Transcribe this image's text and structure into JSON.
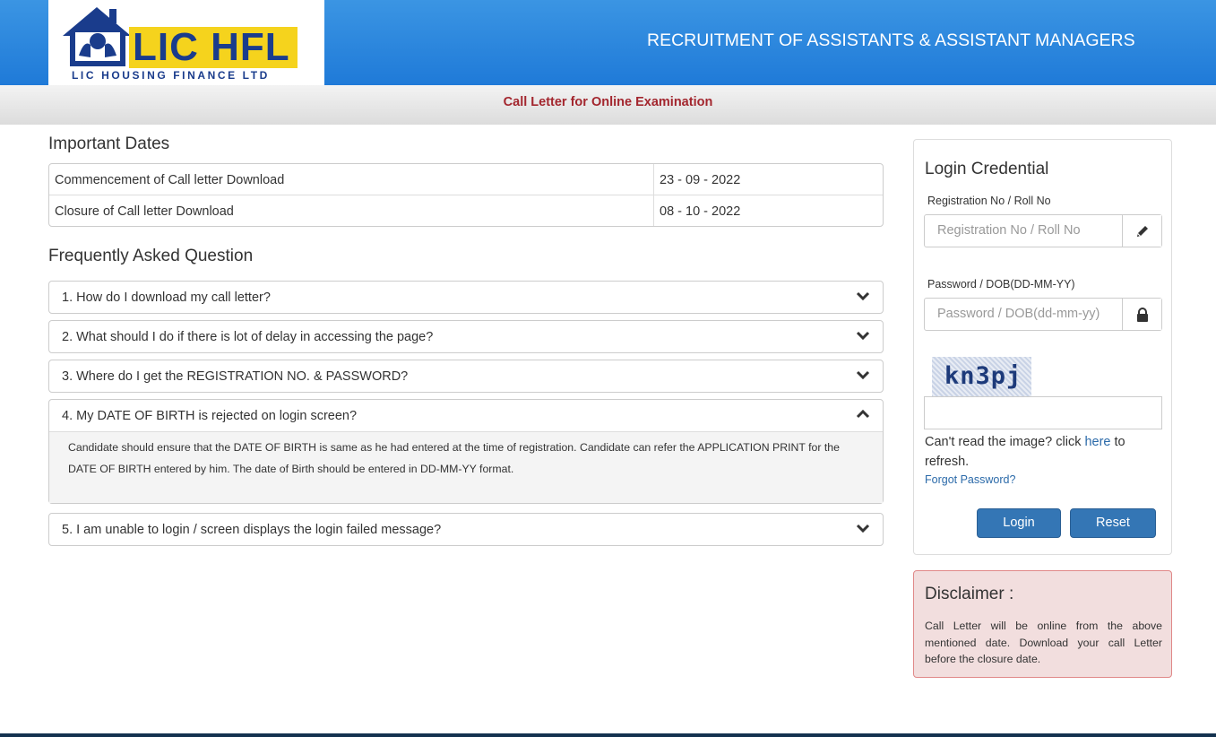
{
  "header": {
    "logo_text": "LIC HFL",
    "logo_subtext": "LIC HOUSING FINANCE LTD",
    "title": "RECRUITMENT OF ASSISTANTS & ASSISTANT MANAGERS",
    "brand_blue": "#1f7ad8",
    "logo_yellow": "#f5d31d"
  },
  "subheader": {
    "title": "Call Letter for Online Examination"
  },
  "important_dates": {
    "heading": "Important Dates",
    "rows": [
      {
        "label": "Commencement of Call letter Download",
        "value": "23 - 09 - 2022"
      },
      {
        "label": "Closure of Call letter Download",
        "value": "08 - 10 - 2022"
      }
    ]
  },
  "faq": {
    "heading": "Frequently Asked Question",
    "items": [
      {
        "question": "1. How do I download my call letter?",
        "expanded": false
      },
      {
        "question": "2. What should I do if there is lot of delay in accessing the page?",
        "expanded": false
      },
      {
        "question": "3. Where do I get the REGISTRATION NO. & PASSWORD?",
        "expanded": false
      },
      {
        "question": "4. My DATE OF BIRTH is rejected on login screen?",
        "expanded": true,
        "answer": "Candidate should ensure that the DATE OF BIRTH is same as he had entered at the time of registration. Candidate can refer the APPLICATION PRINT for the DATE OF BIRTH entered by him. The date of Birth should be entered in DD-MM-YY format."
      },
      {
        "question": "5. I am unable to login / screen displays the login failed message?",
        "expanded": false
      }
    ]
  },
  "login": {
    "title": "Login Credential",
    "reg_label": "Registration No / Roll No",
    "reg_placeholder": "Registration No / Roll No",
    "reg_icon": "pencil-icon",
    "pwd_label": "Password / DOB(DD-MM-YY)",
    "pwd_placeholder": "Password / DOB(dd-mm-yy)",
    "pwd_icon": "lock-icon",
    "captcha_text": "kn3pj",
    "refresh_prefix": "Can't read the image? click ",
    "refresh_link": "here",
    "refresh_suffix": " to refresh.",
    "forgot": "Forgot Password?",
    "login_button": "Login",
    "reset_button": "Reset",
    "button_color": "#3476b5"
  },
  "disclaimer": {
    "title": "Disclaimer :",
    "text": "Call Letter will be online from the above mentioned date. Download your call Letter before the closure date."
  }
}
